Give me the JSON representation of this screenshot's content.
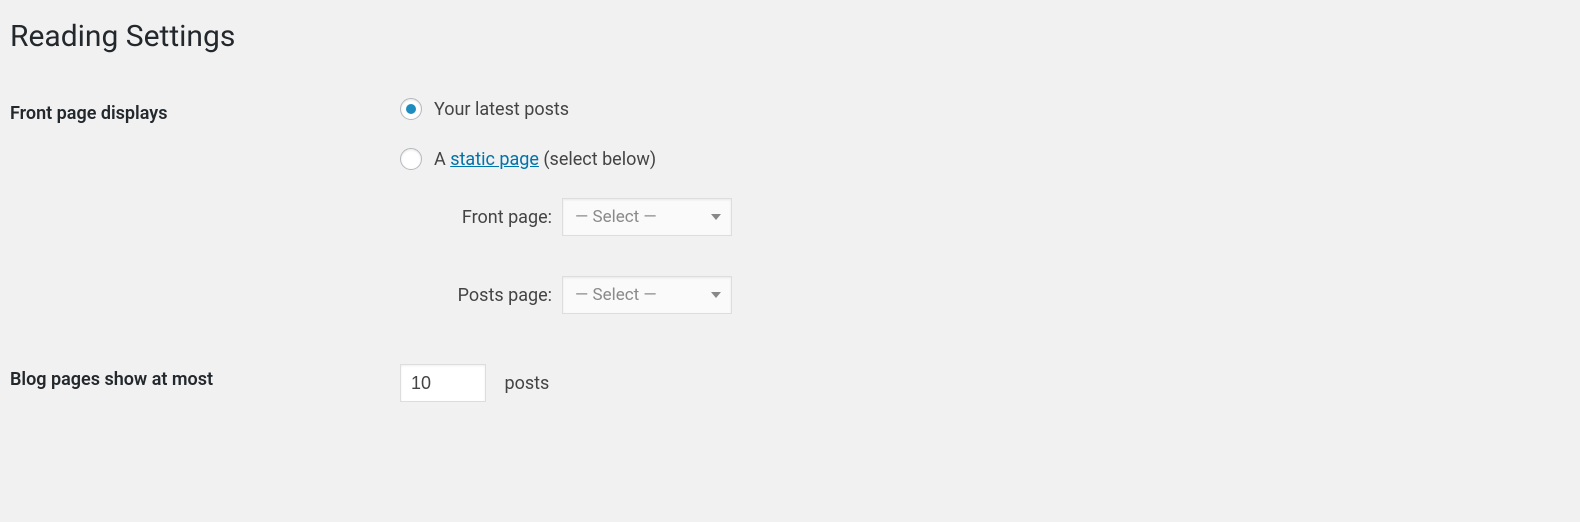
{
  "page": {
    "title": "Reading Settings"
  },
  "front_page": {
    "label": "Front page displays",
    "options": {
      "latest": {
        "label": "Your latest posts",
        "checked": true
      },
      "static": {
        "prefix": "A ",
        "link_text": "static page",
        "suffix": " (select below)",
        "checked": false
      }
    },
    "sub": {
      "front_label": "Front page:",
      "posts_label": "Posts page:",
      "select_placeholder": "— Select —"
    }
  },
  "blog_pages": {
    "label": "Blog pages show at most",
    "value": "10",
    "unit": "posts"
  }
}
